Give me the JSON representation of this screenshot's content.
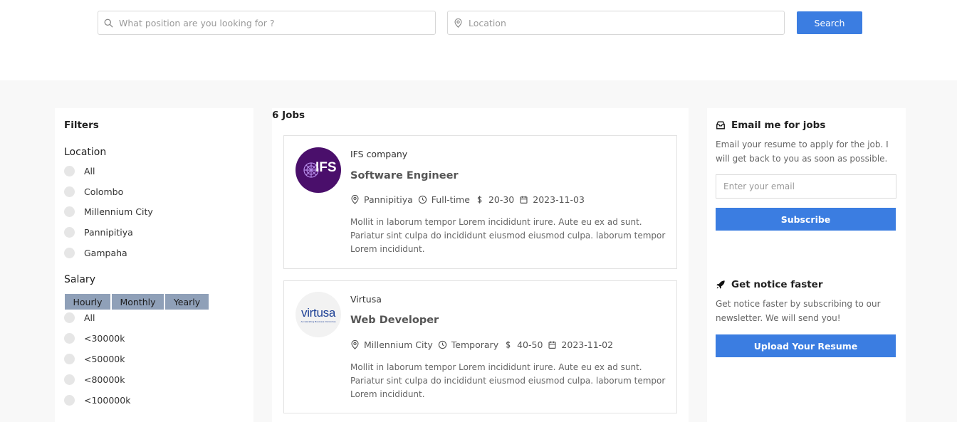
{
  "search": {
    "position_placeholder": "What position are you looking for ?",
    "location_placeholder": "Location",
    "button_label": "Search"
  },
  "filters": {
    "title": "Filters",
    "location_title": "Location",
    "locations": [
      "All",
      "Colombo",
      "Millennium City",
      "Pannipitiya",
      "Gampaha"
    ],
    "salary_title": "Salary",
    "salary_tabs": [
      "Hourly",
      "Monthly",
      "Yearly"
    ],
    "salary_options": [
      "All",
      "<30000k",
      "<50000k",
      "<80000k",
      "<100000k"
    ]
  },
  "jobs": {
    "count_label": "6 Jobs",
    "items": [
      {
        "company": "IFS company",
        "logo_text": "IFS",
        "title": "Software Engineer",
        "location": "Pannipitiya",
        "type": "Full-time",
        "salary": "20-30",
        "date": "2023-11-03",
        "description": "Mollit in laborum tempor Lorem incididunt irure. Aute eu ex ad sunt. Pariatur sint culpa do incididunt eiusmod eiusmod culpa. laborum tempor Lorem incididunt."
      },
      {
        "company": "Virtusa",
        "logo_text": "virtusa",
        "logo_tagline": "Accelerating Business Outcomes",
        "title": "Web Developer",
        "location": "Millennium City",
        "type": "Temporary",
        "salary": "40-50",
        "date": "2023-11-02",
        "description": "Mollit in laborum tempor Lorem incididunt irure. Aute eu ex ad sunt. Pariatur sint culpa do incididunt eiusmod eiusmod culpa. laborum tempor Lorem incididunt."
      }
    ]
  },
  "sidebar": {
    "email_title": "Email me for jobs",
    "email_text": "Email your resume to apply for the job. I will get back to you as soon as possible.",
    "email_placeholder": "Enter your email",
    "subscribe_label": "Subscribe",
    "notice_title": "Get notice faster",
    "notice_text": "Get notice faster by subscribing to our newsletter. We will send you!",
    "upload_label": "Upload Your Resume"
  },
  "colors": {
    "accent": "#3b7de1",
    "tab_bg": "#8fa0b8",
    "ifs_logo_bg": "#4a0f6b",
    "virtusa_blue": "#1c3f95"
  },
  "icons": [
    "search-icon",
    "location-pin-icon",
    "clock-icon",
    "dollar-icon",
    "calendar-icon",
    "inbox-icon",
    "rocket-icon"
  ]
}
